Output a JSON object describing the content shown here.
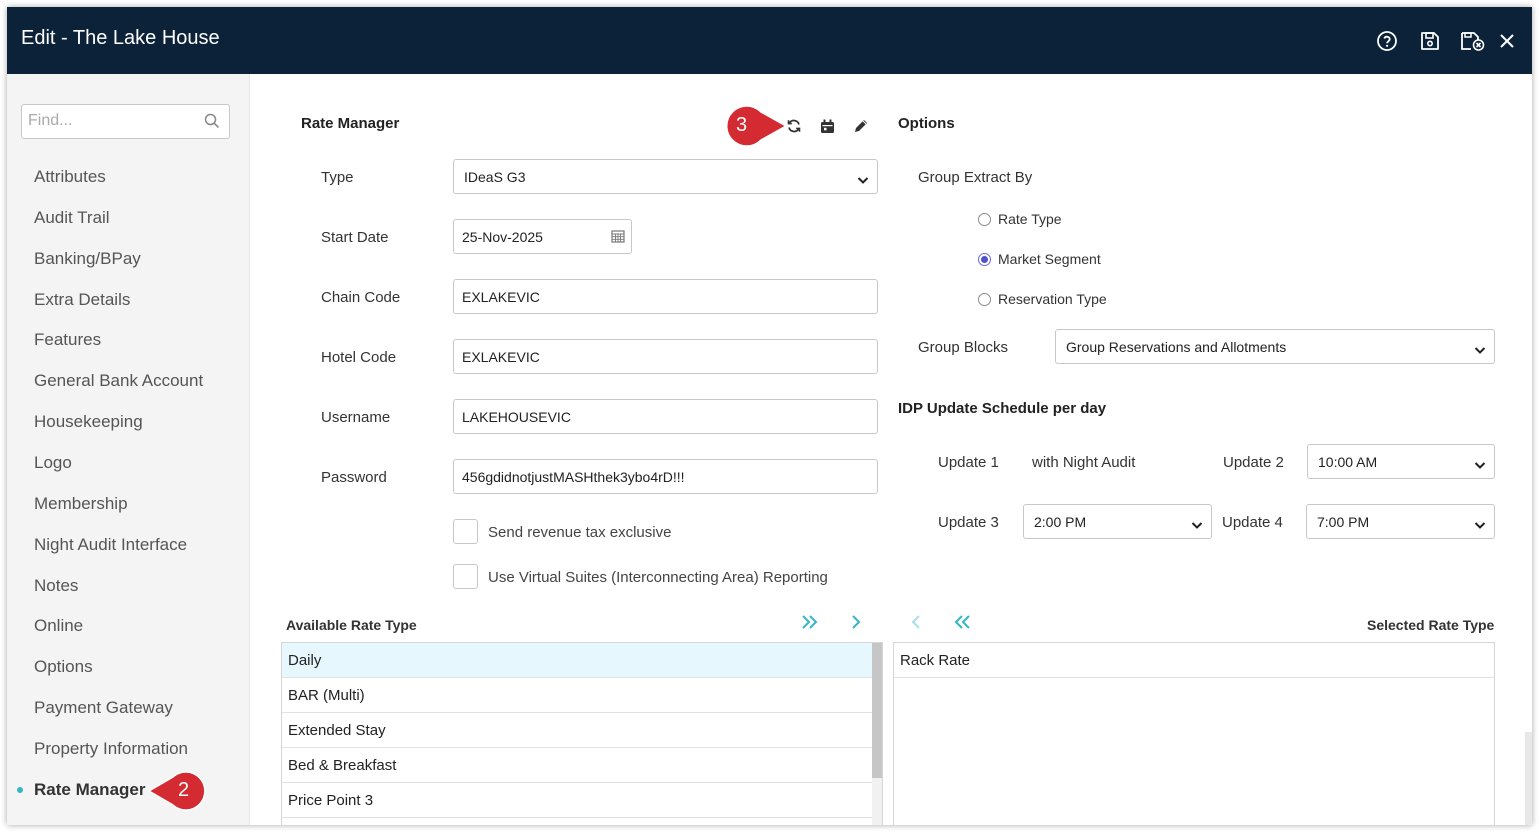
{
  "window": {
    "title": "Edit - The Lake House"
  },
  "titlebar_icons": [
    "help-icon",
    "save-icon",
    "save-close-icon",
    "close-icon"
  ],
  "sidebar": {
    "search_placeholder": "Find...",
    "items": [
      {
        "label": "Attributes"
      },
      {
        "label": "Audit Trail"
      },
      {
        "label": "Banking/BPay"
      },
      {
        "label": "Extra Details"
      },
      {
        "label": "Features"
      },
      {
        "label": "General Bank Account"
      },
      {
        "label": "Housekeeping"
      },
      {
        "label": "Logo"
      },
      {
        "label": "Membership"
      },
      {
        "label": "Night Audit Interface"
      },
      {
        "label": "Notes"
      },
      {
        "label": "Online"
      },
      {
        "label": "Options"
      },
      {
        "label": "Payment Gateway"
      },
      {
        "label": "Property Information"
      },
      {
        "label": "Rate Manager",
        "active": true
      }
    ]
  },
  "callouts": {
    "sidebar": "2",
    "toolbar": "3"
  },
  "rate_manager": {
    "heading": "Rate Manager",
    "type_label": "Type",
    "type_value": "IDeaS G3",
    "start_date_label": "Start Date",
    "start_date_value": "25-Nov-2025",
    "chain_code_label": "Chain Code",
    "chain_code_value": "EXLAKEVIC",
    "hotel_code_label": "Hotel Code",
    "hotel_code_value": "EXLAKEVIC",
    "username_label": "Username",
    "username_value": "LAKEHOUSEVIC",
    "password_label": "Password",
    "password_value": "456gdidnotjustMASHthek3ybo4rD!!!",
    "send_revenue_label": "Send revenue tax exclusive",
    "virtual_suites_label": "Use Virtual Suites (Interconnecting Area) Reporting"
  },
  "options": {
    "heading": "Options",
    "group_extract_label": "Group Extract By",
    "radios": [
      {
        "label": "Rate Type",
        "checked": false
      },
      {
        "label": "Market Segment",
        "checked": true
      },
      {
        "label": "Reservation Type",
        "checked": false
      }
    ],
    "group_blocks_label": "Group Blocks",
    "group_blocks_value": "Group Reservations and Allotments",
    "idp_heading": "IDP Update Schedule per day",
    "update1_label": "Update 1",
    "update1_value": "with Night Audit",
    "update2_label": "Update 2",
    "update2_value": "10:00 AM",
    "update3_label": "Update 3",
    "update3_value": "2:00 PM",
    "update4_label": "Update 4",
    "update4_value": "7:00 PM"
  },
  "rate_types": {
    "available_heading": "Available Rate Type",
    "selected_heading": "Selected Rate Type",
    "available": [
      {
        "label": "Daily",
        "selected": true
      },
      {
        "label": "BAR (Multi)"
      },
      {
        "label": "Extended Stay"
      },
      {
        "label": "Bed & Breakfast"
      },
      {
        "label": "Price Point 3"
      }
    ],
    "selected": [
      {
        "label": "Rack Rate"
      }
    ]
  },
  "colors": {
    "titlebar": "#0b2239",
    "accent": "#35b6c6",
    "callout": "#d42b32"
  }
}
